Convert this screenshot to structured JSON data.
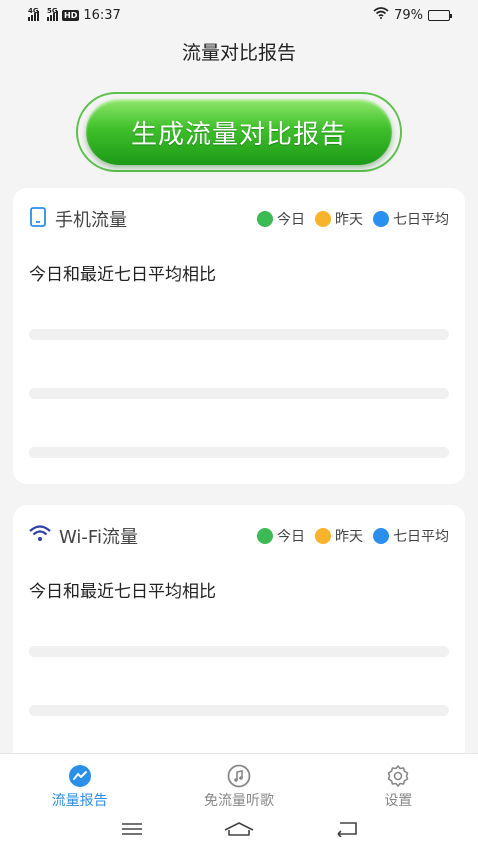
{
  "status_bar": {
    "net1": "4G",
    "net2": "5G",
    "hd": "HD",
    "time": "16:37",
    "battery_text": "79%",
    "battery_level": 0.79
  },
  "header": {
    "title": "流量对比报告"
  },
  "generate_button": {
    "label": "生成流量对比报告"
  },
  "legend": [
    {
      "label": "今日",
      "color": "#3cba54"
    },
    {
      "label": "昨天",
      "color": "#f6b32b"
    },
    {
      "label": "七日平均",
      "color": "#2b8ff0"
    }
  ],
  "cards": [
    {
      "title": "手机流量",
      "subtitle": "今日和最近七日平均相比",
      "icon": "phone-icon"
    },
    {
      "title": "Wi-Fi流量",
      "subtitle": "今日和最近七日平均相比",
      "icon": "wifi-icon"
    }
  ],
  "tabbar": [
    {
      "label": "流量报告",
      "icon": "chart-icon",
      "active": true
    },
    {
      "label": "免流量听歌",
      "icon": "music-icon",
      "active": false
    },
    {
      "label": "设置",
      "icon": "gear-icon",
      "active": false
    }
  ],
  "colors": {
    "accent": "#2a8fe8",
    "button_green": "#3fbf2b"
  }
}
